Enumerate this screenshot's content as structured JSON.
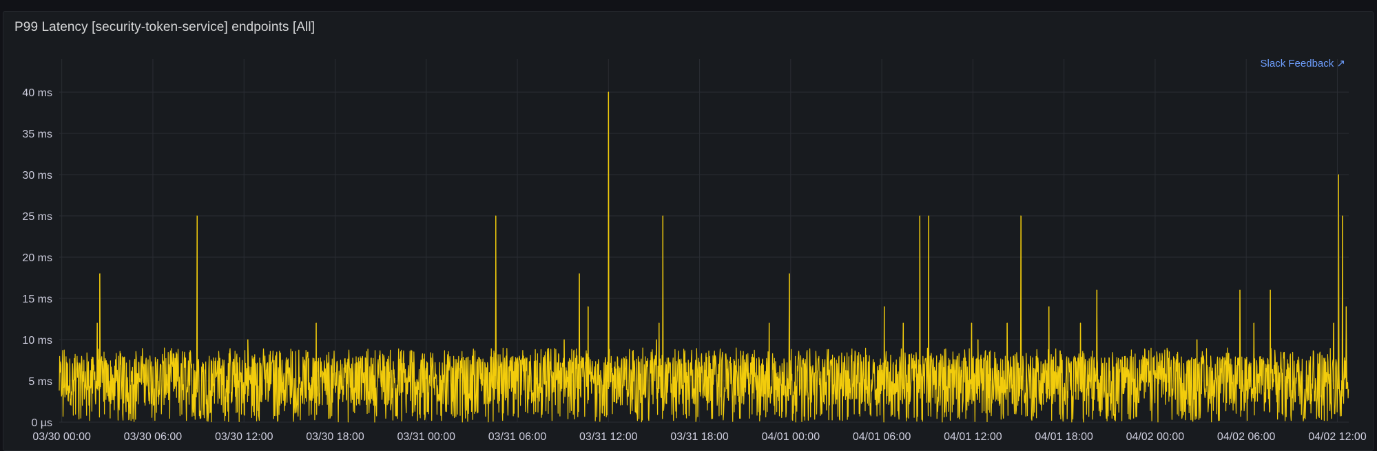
{
  "panel": {
    "title": "P99 Latency [security-token-service] endpoints [All]",
    "link_label": "Slack Feedback ↗"
  },
  "colors": {
    "background": "#181b1f",
    "grid": "#2a2d33",
    "series": "#f2cc0c",
    "text": "#ccccdc",
    "link": "#6e9fff"
  },
  "chart_data": {
    "type": "line",
    "title": "P99 Latency [security-token-service] endpoints [All]",
    "xlabel": "",
    "ylabel": "",
    "ylim": [
      0,
      40
    ],
    "y_unit": "ms",
    "y_ticks": [
      0,
      5,
      10,
      15,
      20,
      25,
      30,
      35,
      40
    ],
    "y_tick_labels": [
      "0 µs",
      "5 ms",
      "10 ms",
      "15 ms",
      "20 ms",
      "25 ms",
      "30 ms",
      "35 ms",
      "40 ms"
    ],
    "x_range": [
      "03/29 23:50",
      "04/02 12:45"
    ],
    "x_ticks": [
      "03/30 00:00",
      "03/30 06:00",
      "03/30 12:00",
      "03/30 18:00",
      "03/31 00:00",
      "03/31 06:00",
      "03/31 12:00",
      "03/31 18:00",
      "04/01 00:00",
      "04/01 06:00",
      "04/01 12:00",
      "04/01 18:00",
      "04/02 00:00",
      "04/02 06:00",
      "04/02 12:00"
    ],
    "grid": true,
    "legend": "none",
    "series": [
      {
        "baseline_range_ms": [
          0,
          9
        ],
        "spikes": [
          {
            "x": "03/30 02:30",
            "y": 18
          },
          {
            "x": "03/30 02:20",
            "y": 12
          },
          {
            "x": "03/30 08:55",
            "y": 25
          },
          {
            "x": "03/30 12:15",
            "y": 10
          },
          {
            "x": "03/30 16:45",
            "y": 12
          },
          {
            "x": "03/31 04:35",
            "y": 25
          },
          {
            "x": "03/31 09:05",
            "y": 10
          },
          {
            "x": "03/31 10:05",
            "y": 18
          },
          {
            "x": "03/31 10:40",
            "y": 14
          },
          {
            "x": "03/31 12:00",
            "y": 40
          },
          {
            "x": "03/31 15:10",
            "y": 10
          },
          {
            "x": "03/31 15:35",
            "y": 25
          },
          {
            "x": "03/31 15:20",
            "y": 12
          },
          {
            "x": "03/31 22:35",
            "y": 12
          },
          {
            "x": "03/31 23:55",
            "y": 18
          },
          {
            "x": "04/01 06:10",
            "y": 14
          },
          {
            "x": "04/01 07:25",
            "y": 12
          },
          {
            "x": "04/01 08:30",
            "y": 25
          },
          {
            "x": "04/01 09:05",
            "y": 25
          },
          {
            "x": "04/01 11:55",
            "y": 12
          },
          {
            "x": "04/01 12:20",
            "y": 10
          },
          {
            "x": "04/01 14:15",
            "y": 12
          },
          {
            "x": "04/01 15:10",
            "y": 25
          },
          {
            "x": "04/01 17:00",
            "y": 14
          },
          {
            "x": "04/01 19:05",
            "y": 12
          },
          {
            "x": "04/01 20:10",
            "y": 16
          },
          {
            "x": "04/02 02:45",
            "y": 10
          },
          {
            "x": "04/02 05:35",
            "y": 16
          },
          {
            "x": "04/02 06:30",
            "y": 12
          },
          {
            "x": "04/02 07:35",
            "y": 16
          },
          {
            "x": "04/02 11:45",
            "y": 12
          },
          {
            "x": "04/02 12:05",
            "y": 30
          },
          {
            "x": "04/02 12:20",
            "y": 25
          },
          {
            "x": "04/02 12:35",
            "y": 14
          }
        ]
      }
    ]
  }
}
